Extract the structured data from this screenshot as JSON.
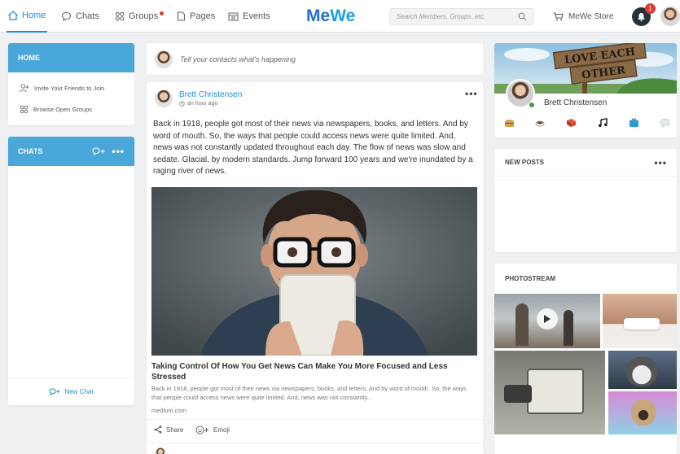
{
  "nav": {
    "items": [
      {
        "label": "Home",
        "icon": "home-icon"
      },
      {
        "label": "Chats",
        "icon": "chat-icon"
      },
      {
        "label": "Groups",
        "icon": "groups-icon"
      },
      {
        "label": "Pages",
        "icon": "pages-icon"
      },
      {
        "label": "Events",
        "icon": "calendar-icon"
      }
    ],
    "logo_part1": "Me",
    "logo_part2": "We",
    "search_placeholder": "Search Members, Groups, etc.",
    "store_label": "MeWe Store",
    "notification_count": "1"
  },
  "sidebar": {
    "home_title": "HOME",
    "links": [
      {
        "label": "Invite Your Friends to Join",
        "icon": "add-user-icon"
      },
      {
        "label": "Browse Open Groups",
        "icon": "grid-icon"
      }
    ],
    "chats_title": "CHATS",
    "new_chat_label": "New Chat"
  },
  "composer": {
    "placeholder": "Tell your contacts what's happening"
  },
  "post": {
    "author": "Brett Christensen",
    "time": "an hour ago",
    "text": "Back in 1918, people got most of their news via newspapers, books, and letters. And by word of mouth. So, the ways that people could access news were quite limited. And, news was not constantly updated throughout each day. The flow of news was slow and sedate. Glacial, by modern standards. Jump forward 100 years and we're inundated by a raging river of news.",
    "link_title": "Taking Control Of How You Get News Can Make You More Focused and Less Stressed",
    "link_desc": "Back in 1918, people got most of their news via newspapers, books, and letters. And by word of mouth. So, the ways that people could access news were quite limited. And, news was not constantly...",
    "link_domain": "medium.com",
    "share_label": "Share",
    "emoji_label": "Emoji"
  },
  "profile": {
    "cover_sign_line1": "LOVE EACH",
    "cover_sign_line2": "OTHER",
    "name": "Brett Christensen",
    "shortcuts": [
      "burger-icon",
      "coffee-icon",
      "book-icon",
      "music-icon",
      "tv-icon",
      "speech-icon"
    ]
  },
  "new_posts": {
    "title": "NEW POSTS"
  },
  "photostream": {
    "title": "PHOTOSTREAM"
  },
  "colors": {
    "accent": "#4aa7d9",
    "nav_active": "#1a8fd6",
    "author_link": "#1a8fd6",
    "badge": "#e53935"
  }
}
